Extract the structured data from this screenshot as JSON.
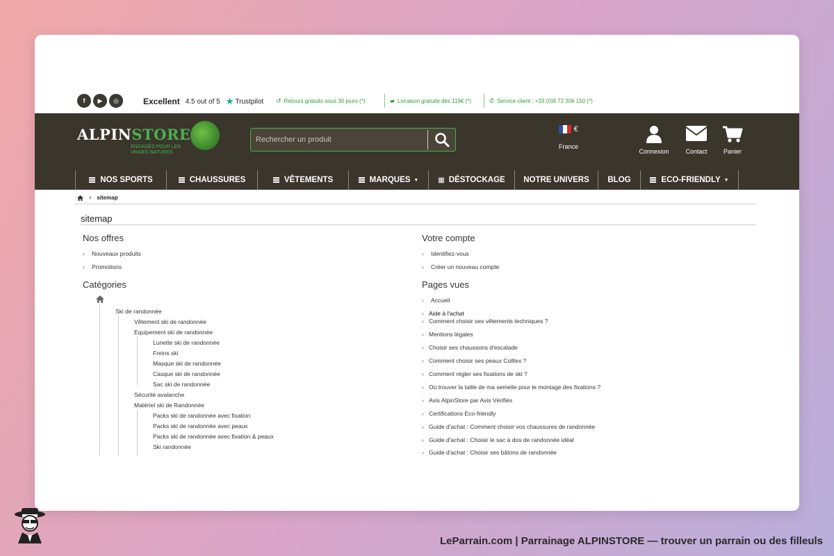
{
  "topbar": {
    "social": [
      "f",
      "▶",
      "◎"
    ],
    "trustpilot": {
      "label": "Excellent",
      "score": "4.5 out of 5",
      "brand": "Trustpilot"
    },
    "usps": [
      "Retours gratuits sous 30 jours (*)",
      "Livraison gratuite dès 119€ (*)",
      "Service client : +33 (0)9 72 306 150 (*)"
    ]
  },
  "header": {
    "logo_main": "ALPIN",
    "logo_accent": "STORE",
    "logo_tagline": "ENGAGÉS POUR LES VRAIES NATURES",
    "search_placeholder": "Rechercher un produit",
    "currency": "€",
    "country": "France",
    "account": "Connexion",
    "contact": "Contact",
    "cart": "Panier"
  },
  "nav": [
    {
      "label": "NOS SPORTS",
      "icon": "menu-icon"
    },
    {
      "label": "CHAUSSURES",
      "icon": "menu-icon"
    },
    {
      "label": "VÊTEMENTS",
      "icon": "menu-icon"
    },
    {
      "label": "MARQUES",
      "icon": "menu-icon",
      "caret": true
    },
    {
      "label": "DÉSTOCKAGE",
      "icon": "tag-icon"
    },
    {
      "label": "NOTRE UNIVERS"
    },
    {
      "label": "BLOG"
    },
    {
      "label": "ECO-FRIENDLY",
      "icon": "menu-icon",
      "caret": true
    }
  ],
  "breadcrumb": {
    "current": "sitemap"
  },
  "page_title": "sitemap",
  "offers": {
    "title": "Nos offres",
    "links": [
      "Nouveaux produits",
      "Promotions"
    ]
  },
  "account": {
    "title": "Votre compte",
    "links": [
      "Identifiez-vous",
      "Créer un nouveau compte"
    ]
  },
  "categories": {
    "title": "Catégories",
    "items": [
      "Ski de randonnée",
      "Vêtement ski de randonnée",
      "Equipement ski de randonnée",
      "Lunette ski de randonnée",
      "Freins ski",
      "Masque ski de randonnée",
      "Casque ski de randonnée",
      "Sac ski de randonnée",
      "Sécurité avalanche",
      "Matériel ski de Randonnée",
      "Packs ski de randonnée avec fixation",
      "Packs ski de randonnée avec peaux",
      "Packs ski de randonnée avec fixation & peaux",
      "Ski randonnée"
    ]
  },
  "pages": {
    "title": "Pages vues",
    "home": "Accueil",
    "group": "Aide à l'achat",
    "links": [
      "Comment choisir ses vêtements techniques ?",
      "Mentions légales",
      "Choisir ses chaussons d'escalade",
      "Comment choisir ses peaux Colltex ?",
      "Comment régler ses fixations de ski ?",
      "Où trouver la taille de ma semelle pour le montage des fixations ?",
      "Avis AlpinStore par Avis Vérifiés",
      "Certifications Eco-friendly",
      "Guide d'achat : Comment choisir vos chaussures de randonnée",
      "Guide d'achat : Choisir le sac à dos de randonnée idéal",
      "Guide d'achat : Choisir ses bâtons de randonnée"
    ]
  },
  "footer": "LeParrain.com | Parrainage ALPINSTORE — trouver un parrain ou des filleuls",
  "colors": {
    "header_bg": "#3a362c",
    "accent_green": "#4caf50",
    "usp_green": "#2e9c3e"
  }
}
